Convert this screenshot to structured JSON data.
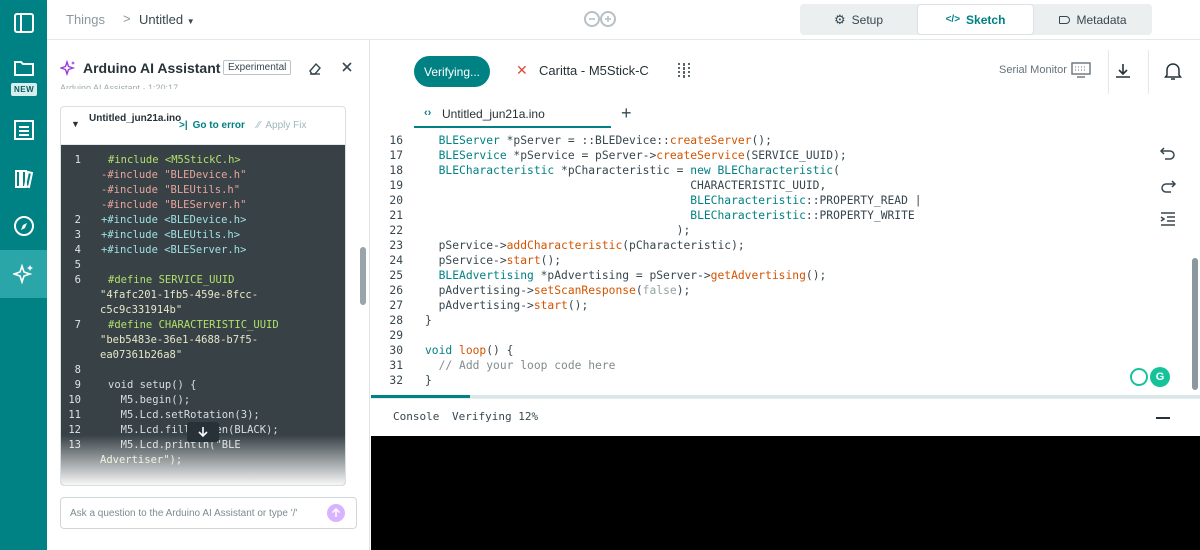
{
  "breadcrumb": {
    "root": "Things",
    "separator": ">",
    "current": "Untitled"
  },
  "top_tabs": [
    {
      "label": "Setup"
    },
    {
      "label": "Sketch"
    },
    {
      "label": "Metadata"
    }
  ],
  "rail": {
    "new_badge": "NEW"
  },
  "assistant": {
    "title": "Arduino AI Assistant",
    "badge": "Experimental",
    "subtitle": "Arduino AI Assistant · 1:20:17",
    "file_name": "Untitled_jun21a.ino",
    "go_to_error": "Go to error",
    "apply_fix": "Apply Fix",
    "code_lines": [
      {
        "n": "1",
        "t": "#include <M5StickC.h>",
        "diff": ""
      },
      {
        "n": "",
        "t": "-#include \"BLEDevice.h\"",
        "diff": "del"
      },
      {
        "n": "",
        "t": "-#include \"BLEUtils.h\"",
        "diff": "del"
      },
      {
        "n": "",
        "t": "-#include \"BLEServer.h\"",
        "diff": "del"
      },
      {
        "n": "2",
        "t": "+#include <BLEDevice.h>",
        "diff": "add"
      },
      {
        "n": "3",
        "t": "+#include <BLEUtils.h>",
        "diff": "add"
      },
      {
        "n": "4",
        "t": "+#include <BLEServer.h>",
        "diff": "add"
      },
      {
        "n": "5",
        "t": "",
        "diff": ""
      },
      {
        "n": "6",
        "t": "#define SERVICE_UUID",
        "diff": ""
      },
      {
        "n": "",
        "t": "\"4fafc201-1fb5-459e-8fcc-",
        "diff": "",
        "indent": "wrap"
      },
      {
        "n": "",
        "t": "c5c9c331914b\"",
        "diff": "",
        "indent": "wrap"
      },
      {
        "n": "7",
        "t": "#define CHARACTERISTIC_UUID",
        "diff": ""
      },
      {
        "n": "",
        "t": "\"beb5483e-36e1-4688-b7f5-",
        "diff": "",
        "indent": "wrap"
      },
      {
        "n": "",
        "t": "ea07361b26a8\"",
        "diff": "",
        "indent": "wrap"
      },
      {
        "n": "8",
        "t": "",
        "diff": ""
      },
      {
        "n": "9",
        "t": "void setup() {",
        "diff": ""
      },
      {
        "n": "10",
        "t": "  M5.begin();",
        "diff": ""
      },
      {
        "n": "11",
        "t": "  M5.Lcd.setRotation(3);",
        "diff": ""
      },
      {
        "n": "12",
        "t": "  M5.Lcd.fillScreen(BLACK);",
        "diff": ""
      },
      {
        "n": "13",
        "t": "  M5.Lcd.println(\"BLE",
        "diff": ""
      },
      {
        "n": "",
        "t": "Advertiser\");",
        "diff": "",
        "indent": "wrap"
      }
    ],
    "ask_placeholder": "Ask a question to the Arduino AI Assistant or type '/'"
  },
  "editor": {
    "verify_label": "Verifying...",
    "board": "Caritta - M5Stick-C",
    "serial_monitor": "Serial Monitor",
    "file_tab": "Untitled_jun21a.ino",
    "lines": [
      {
        "n": "16",
        "t": "  BLEServer *pServer = ::BLEDevice::createServer();"
      },
      {
        "n": "17",
        "t": "  BLEService *pService = pServer->createService(SERVICE_UUID);"
      },
      {
        "n": "18",
        "t": "  BLECharacteristic *pCharacteristic = new BLECharacteristic("
      },
      {
        "n": "19",
        "t": "                                       CHARACTERISTIC_UUID,"
      },
      {
        "n": "20",
        "t": "                                       BLECharacteristic::PROPERTY_READ |"
      },
      {
        "n": "21",
        "t": "                                       BLECharacteristic::PROPERTY_WRITE"
      },
      {
        "n": "22",
        "t": "                                     );"
      },
      {
        "n": "23",
        "t": "  pService->addCharacteristic(pCharacteristic);"
      },
      {
        "n": "24",
        "t": "  pService->start();"
      },
      {
        "n": "25",
        "t": "  BLEAdvertising *pAdvertising = pServer->getAdvertising();"
      },
      {
        "n": "26",
        "t": "  pAdvertising->setScanResponse(false);"
      },
      {
        "n": "27",
        "t": "  pAdvertising->start();"
      },
      {
        "n": "28",
        "t": "}"
      },
      {
        "n": "29",
        "t": ""
      },
      {
        "n": "30",
        "t": "void loop() {"
      },
      {
        "n": "31",
        "t": "  // Add your loop code here"
      },
      {
        "n": "32",
        "t": "}"
      }
    ],
    "progress_fraction": 0.12
  },
  "console": {
    "title": "Console",
    "status": "Verifying 12%"
  },
  "colors": {
    "teal": "#008184",
    "keyword": "#008184",
    "function": "#d35400",
    "string": "#95a5a6",
    "diff_del": "#5b4a4a",
    "diff_add": "#3f5c5f"
  }
}
